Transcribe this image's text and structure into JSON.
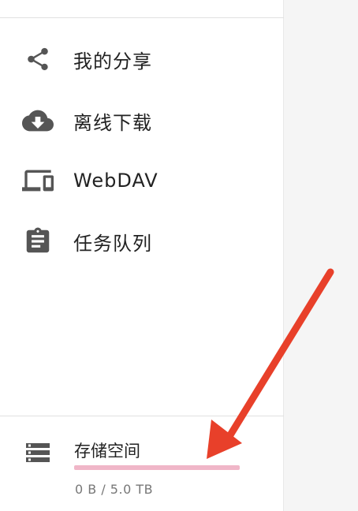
{
  "sidebar": {
    "items": [
      {
        "label": "我的分享",
        "icon": "share-icon"
      },
      {
        "label": "离线下载",
        "icon": "cloud-download-icon"
      },
      {
        "label": "WebDAV",
        "icon": "devices-icon"
      },
      {
        "label": "任务队列",
        "icon": "clipboard-icon"
      }
    ]
  },
  "storage": {
    "title": "存储空间",
    "usage_text": "0 B / 5.0 TB",
    "used_fraction": 0,
    "icon": "storage-icon"
  },
  "colors": {
    "icon": "#555555",
    "storage_bar": "#f0b6c8",
    "arrow": "#e8402a"
  }
}
